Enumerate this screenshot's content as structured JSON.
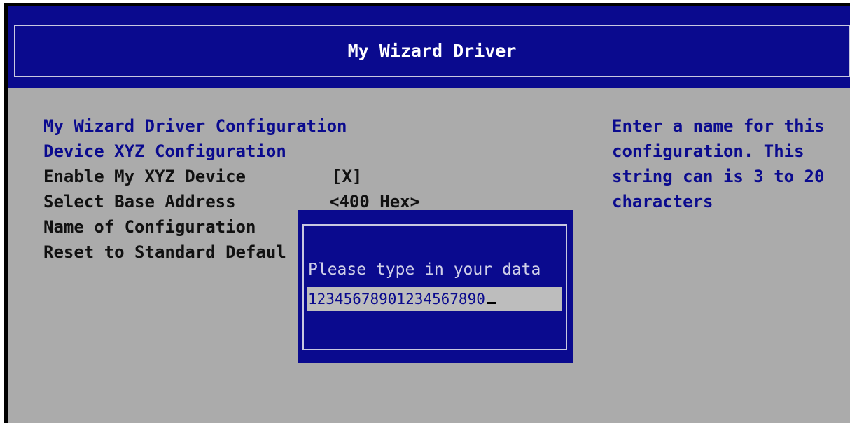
{
  "window": {
    "title": "My Wizard Driver"
  },
  "menu": {
    "heading": "My Wizard Driver Configuration",
    "subheading": "Device XYZ Configuration",
    "items": [
      {
        "label": "Enable My XYZ Device",
        "value": "[X]"
      },
      {
        "label": "Select Base Address",
        "value": "<400 Hex>"
      },
      {
        "label": "Name of Configuration",
        "value": ""
      },
      {
        "label": "Reset to Standard Defaul",
        "value": ""
      }
    ]
  },
  "help": {
    "lines": [
      "Enter a name for this",
      "configuration. This",
      "string can is 3 to 20",
      "characters"
    ]
  },
  "dialog": {
    "prompt": "Please type in your data",
    "input_value": "12345678901234567890"
  },
  "colors": {
    "title_bg": "#0a0a8e",
    "body_bg": "#ababab",
    "highlight_text": "#0a0a8e",
    "normal_text": "#111111",
    "input_bg": "#bdbdbd"
  }
}
